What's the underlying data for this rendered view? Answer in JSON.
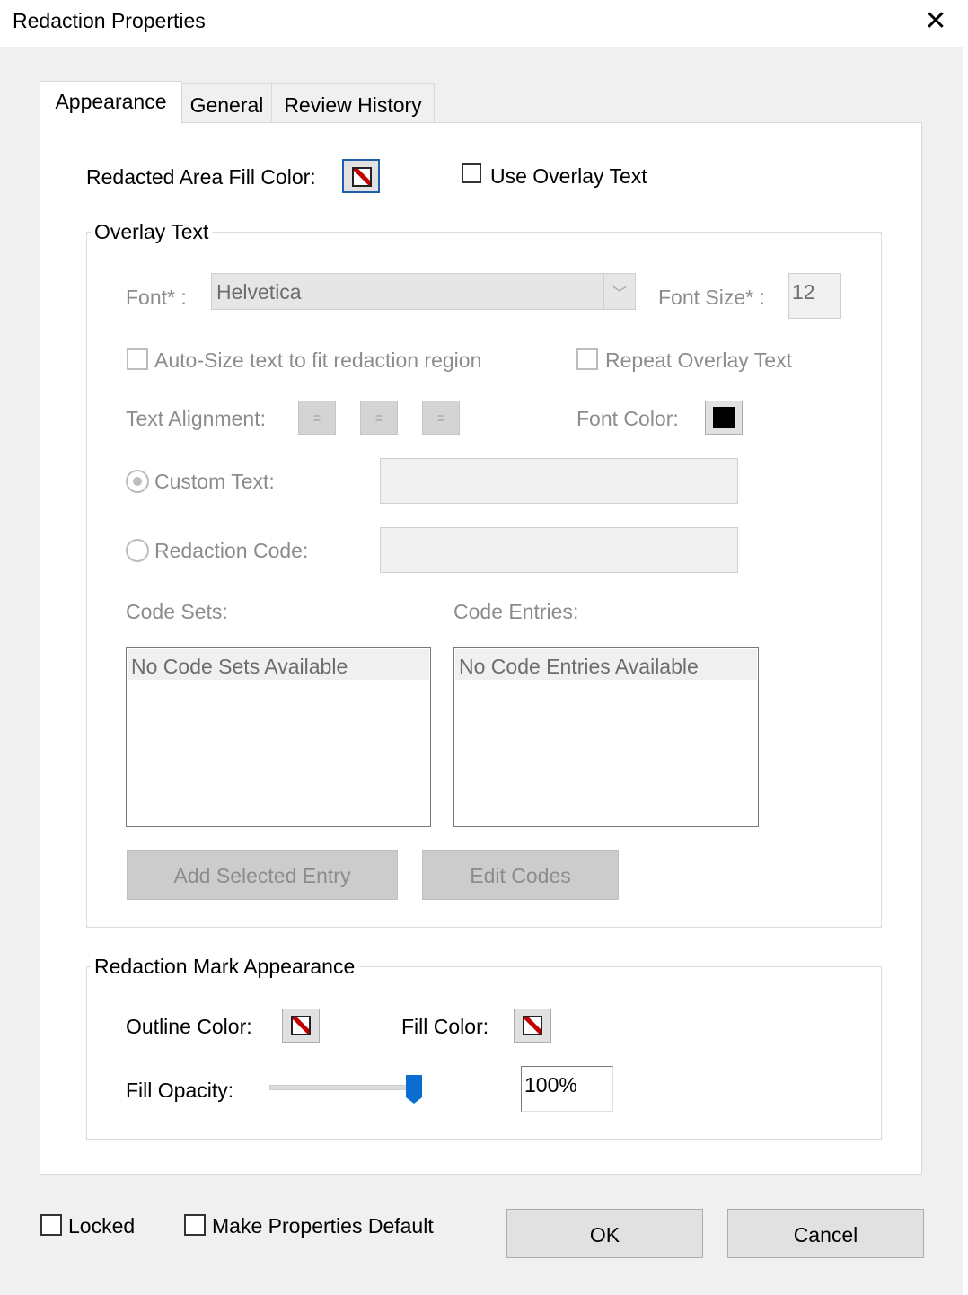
{
  "window": {
    "title": "Redaction Properties",
    "close_icon": "close-icon"
  },
  "tabs": [
    {
      "label": "Appearance",
      "active": true
    },
    {
      "label": "General",
      "active": false
    },
    {
      "label": "Review History",
      "active": false
    }
  ],
  "appearance": {
    "fill_color_label": "Redacted Area Fill Color:",
    "use_overlay_label": "Use Overlay Text",
    "use_overlay_checked": false,
    "overlay": {
      "legend": "Overlay Text",
      "font_label": "Font* :",
      "font_value": "Helvetica",
      "font_size_label": "Font Size* :",
      "font_size_value": "12",
      "autosize_label": "Auto-Size text to fit redaction region",
      "repeat_label": "Repeat Overlay Text",
      "alignment_label": "Text Alignment:",
      "font_color_label": "Font Color:",
      "font_color": "#000000",
      "custom_text_label": "Custom Text:",
      "custom_text_selected": true,
      "redaction_code_label": "Redaction Code:",
      "code_sets_label": "Code Sets:",
      "code_entries_label": "Code Entries:",
      "code_sets_empty": "No Code Sets Available",
      "code_entries_empty": "No Code Entries Available",
      "add_entry_label": "Add Selected Entry",
      "edit_codes_label": "Edit Codes"
    },
    "mark": {
      "legend": "Redaction Mark Appearance",
      "outline_label": "Outline Color:",
      "fill_label": "Fill Color:",
      "opacity_label": "Fill Opacity:",
      "opacity_value": "100%",
      "opacity_fraction": 1.0
    }
  },
  "footer": {
    "locked_label": "Locked",
    "locked_checked": false,
    "default_label": "Make Properties Default",
    "default_checked": false,
    "ok_label": "OK",
    "cancel_label": "Cancel"
  },
  "colors": {
    "no_color_slash": "#c00000",
    "slider_thumb": "#0a6ed1",
    "focus_border": "#1d5fa8"
  }
}
